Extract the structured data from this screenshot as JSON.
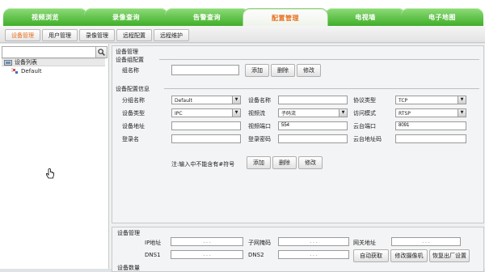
{
  "top_tabs": [
    {
      "label": "视频浏览"
    },
    {
      "label": "录像查询"
    },
    {
      "label": "告警查询"
    },
    {
      "label": "配置管理",
      "active": true
    },
    {
      "label": "电视墙"
    },
    {
      "label": "电子地图"
    }
  ],
  "sub_tabs": [
    {
      "label": "设备管理",
      "active": true
    },
    {
      "label": "用户管理"
    },
    {
      "label": "录像管理"
    },
    {
      "label": "远程配置"
    },
    {
      "label": "远程维护"
    }
  ],
  "left_panel": {
    "search_value": "",
    "tree_root": "设备列表",
    "tree_child": "Default"
  },
  "device_manage": {
    "title": "设备管理",
    "group_config": {
      "title": "设备组配置",
      "group_name_label": "组名称",
      "group_name_value": "",
      "add_label": "添加",
      "delete_label": "删除",
      "modify_label": "修改"
    },
    "config_info": {
      "title": "设备配置信息",
      "subgroup_label": "分组名称",
      "subgroup_value": "Default",
      "device_name_label": "设备名称",
      "device_name_value": "",
      "protocol_label": "协议类型",
      "protocol_value": "TCP",
      "device_type_label": "设备类型",
      "device_type_value": "IPC",
      "stream_label": "视频流",
      "stream_value": "子码流",
      "access_label": "访问模式",
      "access_value": "RTSP",
      "address_label": "设备地址",
      "address_value": "",
      "video_port_label": "视频端口",
      "video_port_value": "554",
      "cloud_port_label": "云台端口",
      "cloud_port_value": "8091",
      "login_label": "登录名",
      "login_value": "",
      "password_label": "登录密码",
      "password_value": "",
      "cloud_addr_label": "云台地址码",
      "cloud_addr_value": "",
      "note": "注:输入中不能含有#符号",
      "add_label": "添加",
      "delete_label": "删除",
      "modify_label": "修改"
    }
  },
  "bottom_manage": {
    "title": "设备管理",
    "ip_label": "IP地址",
    "mask_label": "子网掩码",
    "gateway_label": "网关地址",
    "dns1_label": "DNS1",
    "dns2_label": "DNS2",
    "auto_label": "自动获取",
    "modify_cam_label": "修改摄像机",
    "factory_label": "恢复出厂设置",
    "device_count_label": "设备数量",
    "ip_dots": ". . ."
  }
}
